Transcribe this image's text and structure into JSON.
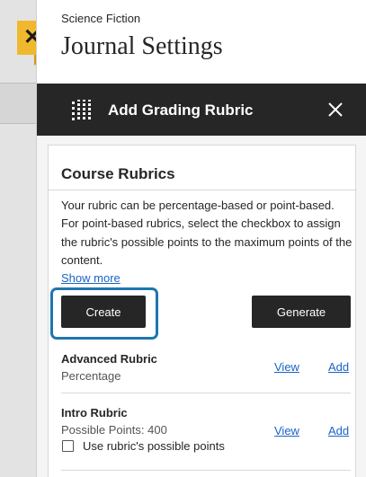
{
  "panel": {
    "breadcrumb": "Science Fiction",
    "title": "Journal Settings",
    "close_icon": "close-x-icon"
  },
  "subpanel": {
    "title": "Add Grading Rubric",
    "icon": "rubric-grid-icon",
    "close_icon": "close-x-icon"
  },
  "card": {
    "title": "Course Rubrics",
    "description": "Your rubric can be percentage-based or point-based. For point-based rubrics, select the checkbox to assign the rubric's possible points to the maximum points of the content.",
    "show_more": "Show more",
    "create_label": "Create",
    "generate_label": "Generate"
  },
  "rubrics": [
    {
      "name": "Advanced Rubric",
      "detail": "Percentage",
      "view": "View",
      "add": "Add"
    },
    {
      "name": "Intro Rubric",
      "detail": "Possible Points: 400",
      "view": "View",
      "add": "Add",
      "checkbox_label": "Use rubric's possible points"
    }
  ],
  "colors": {
    "accent_tab": "#f0b92d",
    "dark": "#262626",
    "link": "#1a63c7",
    "focus": "#1e76b0"
  }
}
